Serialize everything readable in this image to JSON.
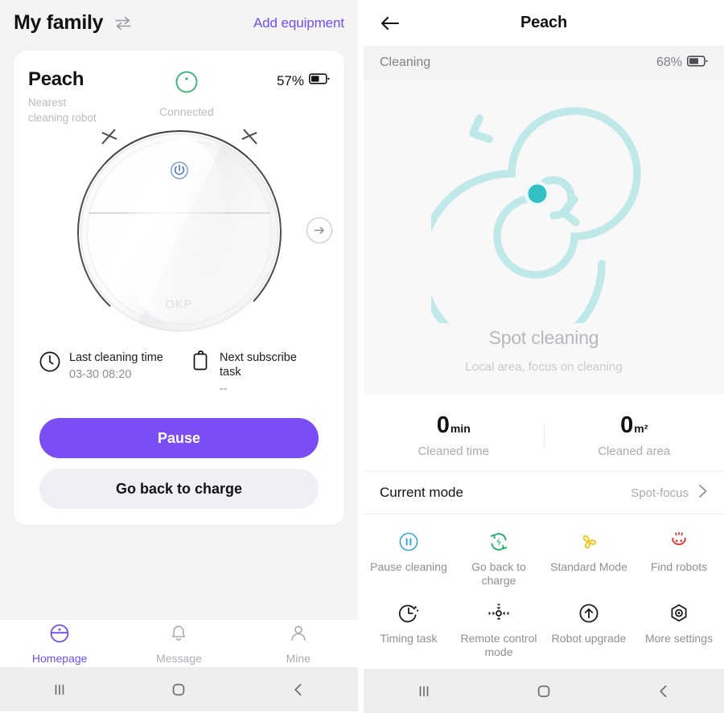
{
  "left": {
    "header": {
      "title": "My family",
      "swap_icon": "swap-arrows-icon",
      "add_equipment": "Add equipment"
    },
    "device_card": {
      "name": "Peach",
      "subtitle": "Nearest\ncleaning robot",
      "subtitle_line1": "Nearest",
      "subtitle_line2": "cleaning robot",
      "connection_status": "Connected",
      "connection_icon": "status-ring-icon",
      "connection_color": "#2bb673",
      "battery_percent": "57%",
      "battery_icon": "battery-icon",
      "battery_level": 57,
      "robot_brand": "OKP",
      "power_icon": "power-button-icon",
      "next_arrow_icon": "arrow-right-circle-icon",
      "info": [
        {
          "icon": "clock-icon",
          "label": "Last cleaning time",
          "value": "03-30 08:20"
        },
        {
          "icon": "clipboard-icon",
          "label": "Next subscribe task",
          "value": "--"
        }
      ],
      "primary_button": "Pause",
      "secondary_button": "Go back to charge",
      "accent_color": "#7b4ef5"
    },
    "tabs": [
      {
        "label": "Homepage",
        "icon": "homepage-robot-icon",
        "active": true
      },
      {
        "label": "Message",
        "icon": "bell-icon",
        "active": false
      },
      {
        "label": "Mine",
        "icon": "person-icon",
        "active": false
      }
    ]
  },
  "right": {
    "header": {
      "back_icon": "arrow-left-icon",
      "title": "Peach"
    },
    "status": {
      "text": "Cleaning",
      "battery_percent": "68%",
      "battery_icon": "battery-icon",
      "battery_level": 68
    },
    "spot": {
      "illustration": "spiral-spot-cleaning-icon",
      "spiral_color": "#bfe8e8",
      "center_dot_color": "#32bfc4",
      "title": "Spot cleaning",
      "subtitle": "Local area, focus on cleaning"
    },
    "stats": [
      {
        "value": "0",
        "unit": "min",
        "label": "Cleaned time"
      },
      {
        "value": "0",
        "unit": "m²",
        "label": "Cleaned area"
      }
    ],
    "mode": {
      "label": "Current mode",
      "value": "Spot-focus",
      "chevron_icon": "chevron-right-icon"
    },
    "actions": [
      {
        "label": "Pause cleaning",
        "icon": "pause-circle-icon",
        "color": "#3aa8e0"
      },
      {
        "label": "Go back to charge",
        "icon": "recharge-refresh-icon",
        "color": "#1eb36b"
      },
      {
        "label": "Standard Mode",
        "icon": "fan-icon",
        "color": "#f5c518"
      },
      {
        "label": "Find robots",
        "icon": "find-robot-face-icon",
        "color": "#e03434"
      },
      {
        "label": "Timing task",
        "icon": "timer-icon",
        "color": "#1b1c20"
      },
      {
        "label": "Remote control mode",
        "icon": "dpad-move-icon",
        "color": "#1b1c20"
      },
      {
        "label": "Robot upgrade",
        "icon": "upgrade-arrow-up-icon",
        "color": "#1b1c20"
      },
      {
        "label": "More settings",
        "icon": "settings-gear-icon",
        "color": "#1b1c20"
      }
    ]
  },
  "android_nav": {
    "recent_icon": "recent-apps-icon",
    "home_icon": "home-square-icon",
    "back_icon": "back-chevron-icon"
  }
}
